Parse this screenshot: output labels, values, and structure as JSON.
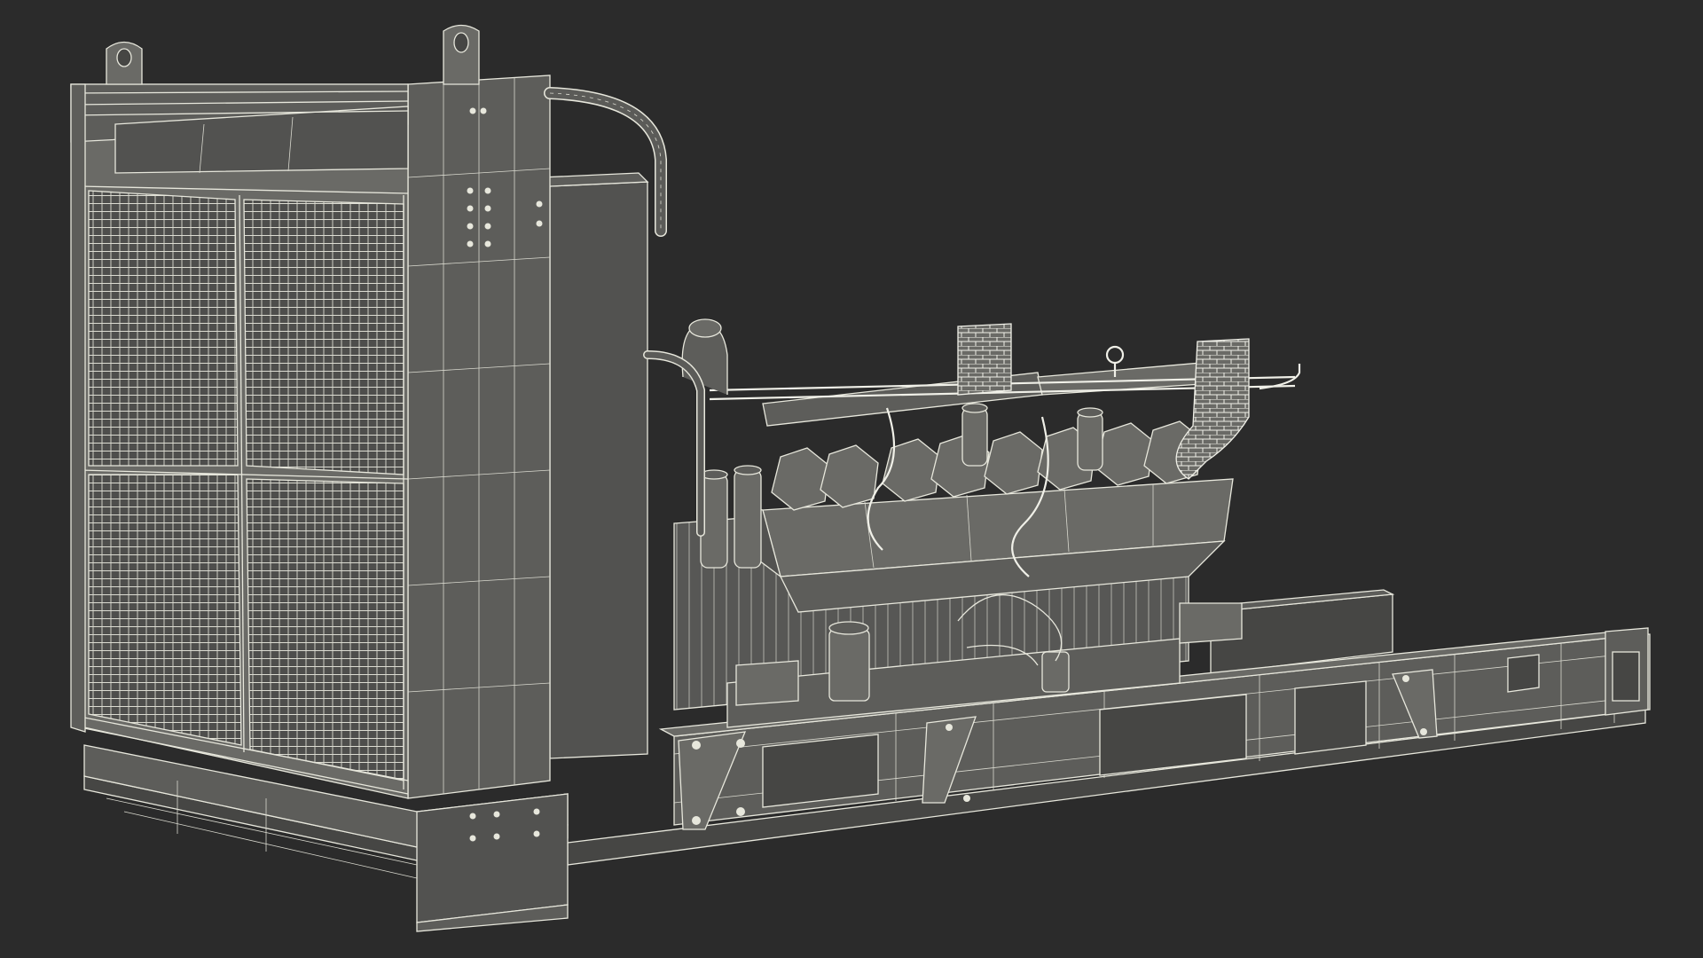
{
  "scene": {
    "subject": "",
    "colors": {
      "background": "#2b2b2b",
      "wire": "#e7e7dc",
      "surface": "#555553"
    }
  }
}
